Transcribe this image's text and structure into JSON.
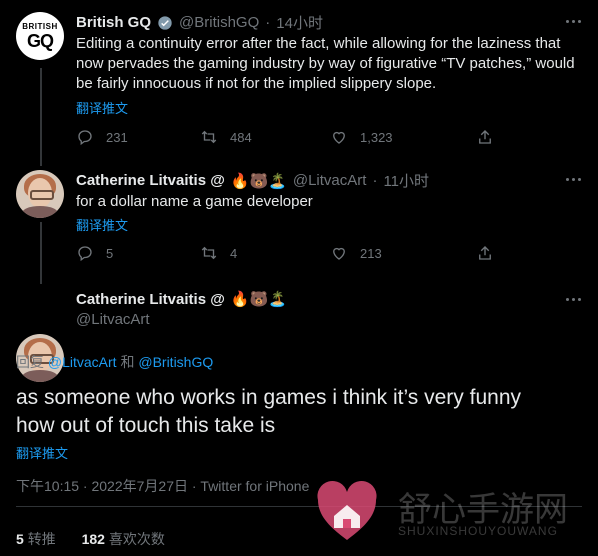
{
  "tweet1": {
    "name": "British GQ",
    "handle": "@BritishGQ",
    "time": "14小时",
    "logo_top": "BRITISH",
    "logo_bottom": "GQ",
    "text_lines": [
      "Editing a continuity error after the fact, while allowing for the laziness that",
      "now pervades the gaming industry by way of figurative “TV patches,” would",
      "be fairly innocuous if not for the implied slippery slope."
    ],
    "translate": "翻译推文",
    "replies": "231",
    "retweets": "484",
    "likes": "1,323"
  },
  "tweet2": {
    "name": "Catherine Litvaitis @",
    "emojis": "🔥🐻🏝️",
    "handle": "@LitvacArt",
    "time": "11小时",
    "text": "for a dollar name a game developer",
    "translate": "翻译推文",
    "replies": "5",
    "retweets": "4",
    "likes": "213"
  },
  "main_tweet": {
    "name": "Catherine Litvaitis @",
    "emojis": "🔥🐻🏝️",
    "handle": "@LitvacArt",
    "reply_prefix": "回复",
    "reply_handle_1": "@LitvacArt",
    "reply_and": "和",
    "reply_handle_2": "@BritishGQ",
    "text_lines": [
      "as someone who works in games i think it’s very funny",
      "how out of touch this take is"
    ],
    "translate": "翻译推文",
    "timestamp": "下午10:15 · 2022年7月27日 · Twitter for iPhone",
    "retweet_count": "5",
    "retweet_label": "转推",
    "like_count": "182",
    "like_label": "喜欢次数"
  },
  "watermark": {
    "title": "舒心手游网",
    "subtitle": "SHUXINSHOUYOUWANG"
  }
}
